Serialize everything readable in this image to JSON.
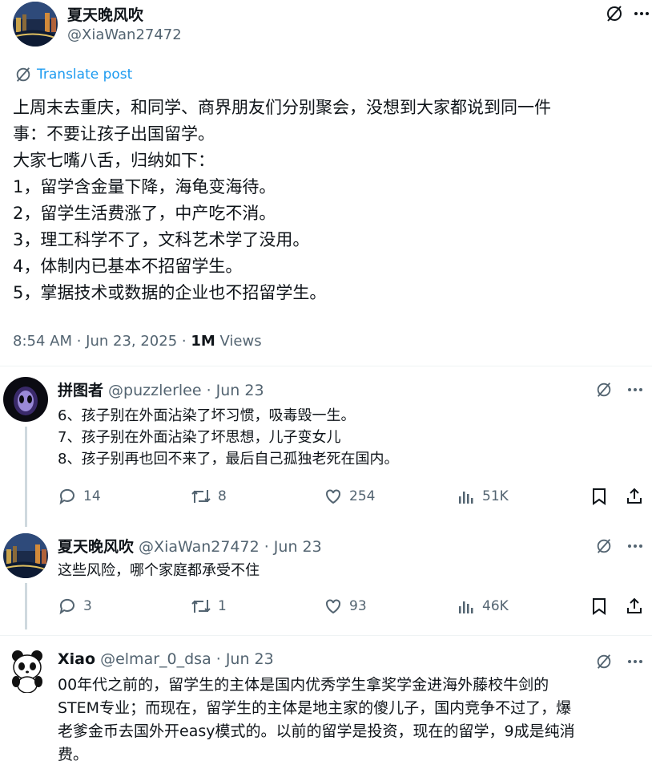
{
  "main_post": {
    "author_name": "夏天晚风吹",
    "author_handle": "@XiaWan27472",
    "translate_label": "Translate post",
    "lines": [
      "上周末去重庆，和同学、商界朋友们分别聚会，没想到大家都说到同一件",
      "事：不要让孩子出国留学。",
      "大家七嘴八舌，归纳如下：",
      "1，留学含金量下降，海龟变海待。",
      "2，留学生活费涨了，中产吃不消。",
      "3，理工科学不了，文科艺术学了没用。",
      "4，体制内已基本不招留学生。",
      "5，掌据技术或数据的企业也不招留学生。"
    ],
    "time": "8:54 AM · Jun 23, 2025 · ",
    "views_count": "1M",
    "views_label": " Views"
  },
  "replies": [
    {
      "name": "拼图者",
      "handle_date": " @puzzlerlee · Jun 23",
      "lines": [
        "6、孩子别在外面沾染了坏习惯，吸毒毁一生。",
        "7、孩子别在外面沾染了坏思想，儿子变女儿",
        "8、孩子别再也回不来了，最后自己孤独老死在国内。"
      ],
      "replies": "14",
      "reposts": "8",
      "likes": "254",
      "views": "51K"
    },
    {
      "name": "夏天晚风吹",
      "handle_date": " @XiaWan27472 · Jun 23",
      "lines": [
        "这些风险，哪个家庭都承受不住"
      ],
      "replies": "3",
      "reposts": "1",
      "likes": "93",
      "views": "46K"
    },
    {
      "name": "Xiao",
      "handle_date": " @elmar_0_dsa · Jun 23",
      "lines": [
        "00年代之前的，留学生的主体是国内优秀学生拿奖学金进海外藤校牛剑的",
        "STEM专业；而现在，留学生的主体是地主家的傻儿子，国内竞争不过了，爆",
        "老爹金币去国外开easy模式的。以前的留学是投资，现在的留学，9成是纯消",
        "费。"
      ]
    }
  ],
  "colors": {
    "accent": "#1d9bf0",
    "secondary_text": "#536471",
    "primary_text": "#0f1419"
  },
  "icons": [
    "grok-icon",
    "more-icon",
    "reply-icon",
    "repost-icon",
    "like-icon",
    "views-icon",
    "bookmark-icon",
    "share-icon"
  ]
}
